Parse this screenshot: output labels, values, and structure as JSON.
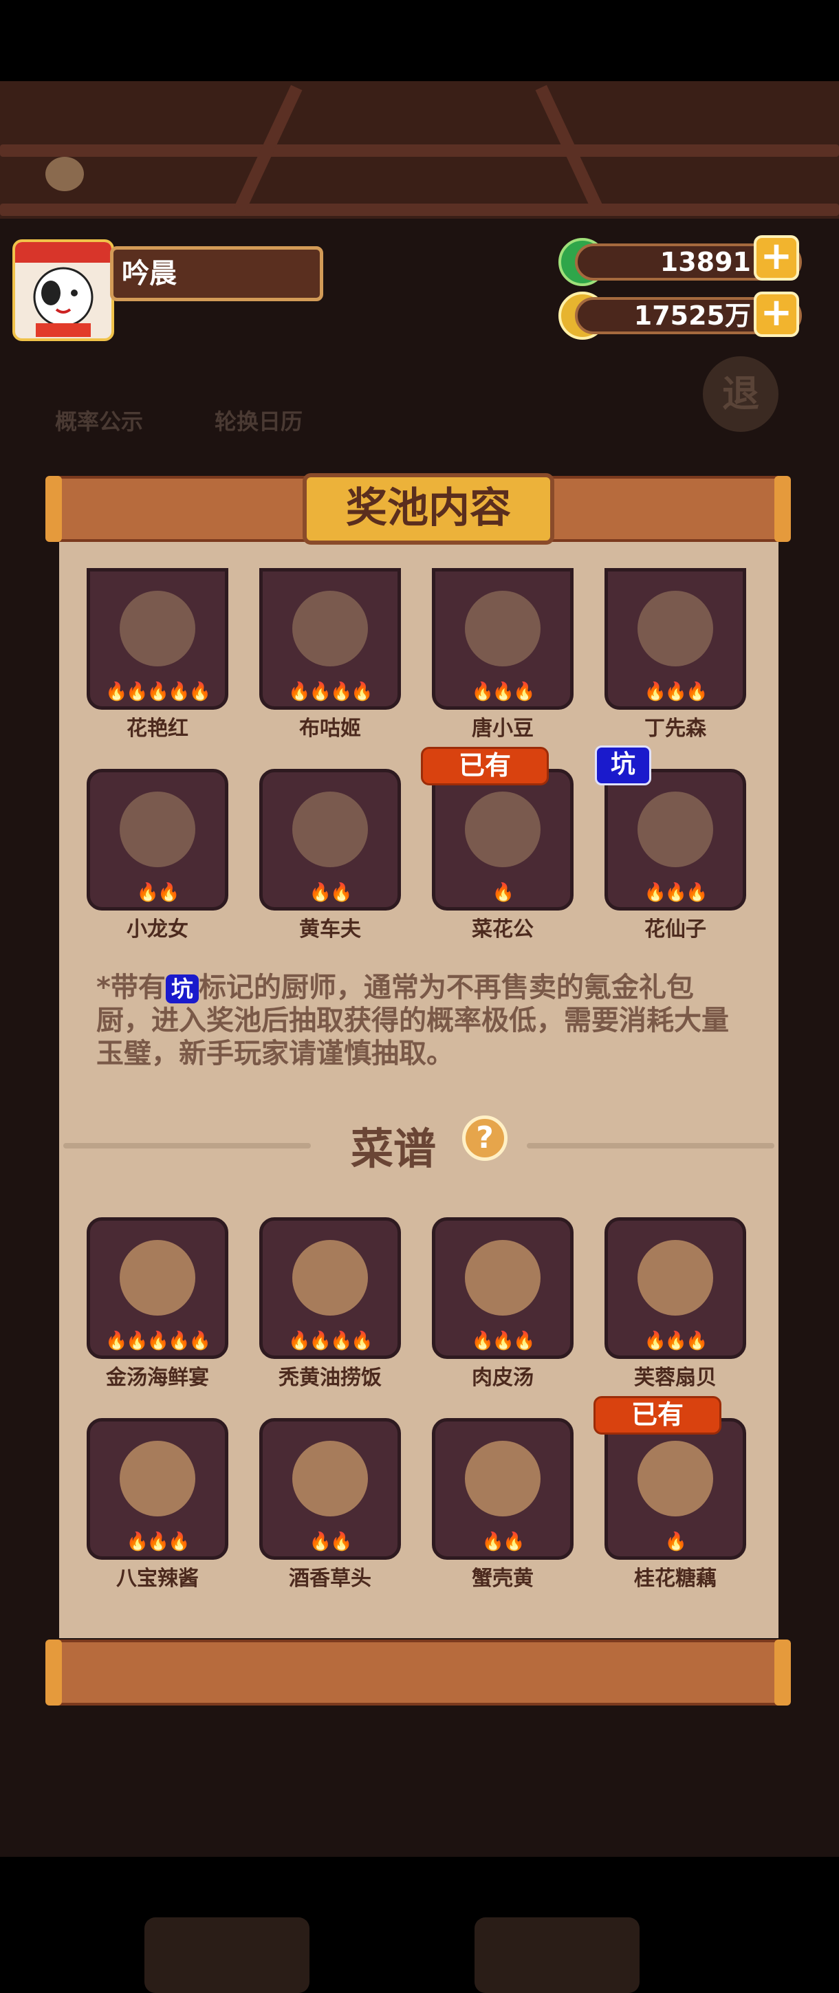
{
  "player": {
    "name": "吟晨"
  },
  "currency": {
    "jade": "13891",
    "coins": "17525万",
    "plus": "+"
  },
  "background": {
    "prob_label": "概率公示",
    "calendar_label": "轮换日历",
    "exit_label": "退"
  },
  "panel": {
    "title": "奖池内容"
  },
  "chefs": [
    {
      "name": "花艳红",
      "flames": "🔥🔥🔥🔥🔥",
      "badge": ""
    },
    {
      "name": "布咕姬",
      "flames": "🔥🔥🔥🔥",
      "badge": ""
    },
    {
      "name": "唐小豆",
      "flames": "🔥🔥🔥",
      "badge": ""
    },
    {
      "name": "丁先森",
      "flames": "🔥🔥🔥",
      "badge": ""
    },
    {
      "name": "小龙女",
      "flames": "🔥🔥",
      "badge": ""
    },
    {
      "name": "黄车夫",
      "flames": "🔥🔥",
      "badge": ""
    },
    {
      "name": "菜花公",
      "flames": "🔥",
      "badge": "已有"
    },
    {
      "name": "花仙子",
      "flames": "🔥🔥🔥",
      "badge": "坑"
    }
  ],
  "note": {
    "prefix": "*带有",
    "pit": "坑",
    "text": "标记的厨师，通常为不再售卖的氪金礼包厨，进入奖池后抽取获得的概率极低，需要消耗大量玉璧，新手玩家请谨慎抽取。"
  },
  "recipes_section": {
    "title": "菜谱",
    "help": "?"
  },
  "recipes": [
    {
      "name": "金汤海鲜宴",
      "flames": "🔥🔥🔥🔥🔥",
      "badge": ""
    },
    {
      "name": "秃黄油捞饭",
      "flames": "🔥🔥🔥🔥",
      "badge": ""
    },
    {
      "name": "肉皮汤",
      "flames": "🔥🔥🔥",
      "badge": ""
    },
    {
      "name": "芙蓉扇贝",
      "flames": "🔥🔥🔥",
      "badge": ""
    },
    {
      "name": "八宝辣酱",
      "flames": "🔥🔥🔥",
      "badge": ""
    },
    {
      "name": "酒香草头",
      "flames": "🔥🔥",
      "badge": ""
    },
    {
      "name": "蟹壳黄",
      "flames": "🔥🔥",
      "badge": ""
    },
    {
      "name": "桂花糖藕",
      "flames": "🔥",
      "badge": "已有"
    }
  ],
  "colors": {
    "paper": "#d3b99e",
    "tile": "#4a2a34",
    "accent": "#ecb23a",
    "owned": "#d9420f",
    "pit": "#1a1acc"
  }
}
